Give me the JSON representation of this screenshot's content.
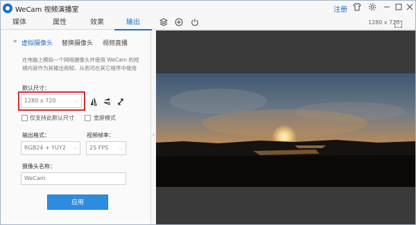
{
  "app": {
    "title": "WeCam 视频演播室",
    "register_label": "注册"
  },
  "titlebar_icons": [
    "shirt-icon",
    "settings-icon",
    "minimize-icon",
    "maximize-icon",
    "close-icon"
  ],
  "tabs": [
    {
      "label": "媒体",
      "active": false
    },
    {
      "label": "属性",
      "active": false
    },
    {
      "label": "效果",
      "active": false
    },
    {
      "label": "输出",
      "active": true
    }
  ],
  "toolbar_icons": [
    "layers-icon",
    "add-circle-icon",
    "power-icon"
  ],
  "preview": {
    "resolution": "1280 x 720"
  },
  "panel": {
    "subtabs": [
      {
        "label": "虚拟摄像头",
        "active": true
      },
      {
        "label": "替换摄像头",
        "active": false
      },
      {
        "label": "视频直播",
        "active": false
      }
    ],
    "description": "在电脑上模拟一个网络摄像头并使用 WeCam 的视频内容作为其输出视频，从而可在其它程序中使用",
    "default_size_label": "默认尺寸：",
    "default_size_value": "1280 x 720",
    "only_default_label": "仅支持此默认尺寸",
    "widescreen_label": "宽屏模式",
    "format_label": "输出格式：",
    "format_value": "RGB24 + YUY2",
    "fps_label": "视频帧率：",
    "fps_value": "25 FPS",
    "camera_name_label": "摄像头名称：",
    "camera_name_value": "WeCam",
    "apply_label": "应用"
  },
  "colors": {
    "accent": "#1f6fc5",
    "highlight": "#d42a2a",
    "apply_button": "#2d8ce0"
  }
}
